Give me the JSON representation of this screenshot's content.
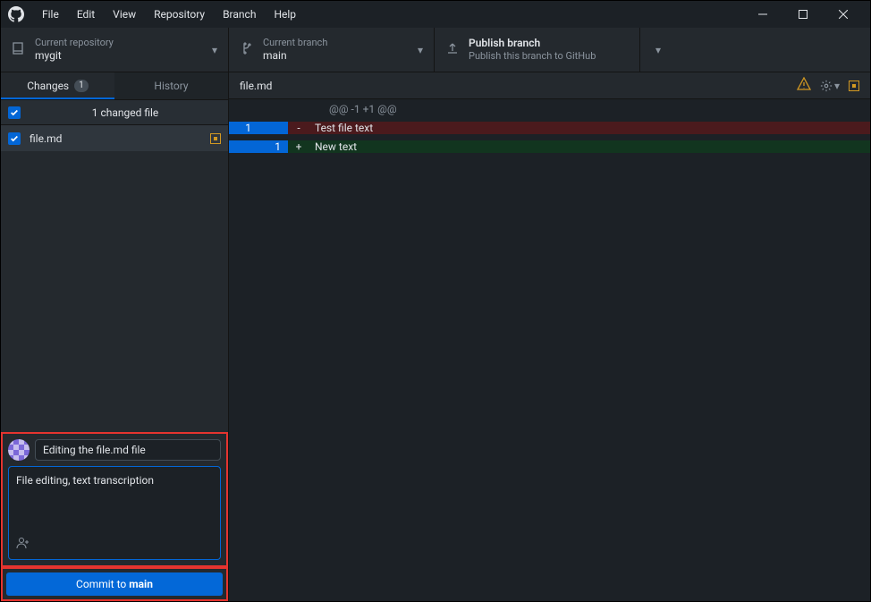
{
  "menu": [
    "File",
    "Edit",
    "View",
    "Repository",
    "Branch",
    "Help"
  ],
  "toolbar": {
    "repo": {
      "label": "Current repository",
      "value": "mygit"
    },
    "branch": {
      "label": "Current branch",
      "value": "main"
    },
    "publish": {
      "title": "Publish branch",
      "subtitle": "Publish this branch to GitHub"
    }
  },
  "tabs": {
    "changes": {
      "label": "Changes",
      "count": "1"
    },
    "history": {
      "label": "History"
    }
  },
  "changes": {
    "summary": "1 changed file",
    "files": [
      {
        "name": "file.md"
      }
    ]
  },
  "commit": {
    "summary_value": "Editing the file.md file",
    "description_value": "File editing, text transcription",
    "button_prefix": "Commit to ",
    "button_branch": "main"
  },
  "diff": {
    "file": "file.md",
    "hunk": "@@ -1 +1 @@",
    "lines": [
      {
        "old": "1",
        "new": "",
        "sign": "-",
        "text": "Test file text",
        "type": "deletion"
      },
      {
        "old": "",
        "new": "1",
        "sign": "+",
        "text": "New text",
        "type": "addition"
      }
    ]
  }
}
